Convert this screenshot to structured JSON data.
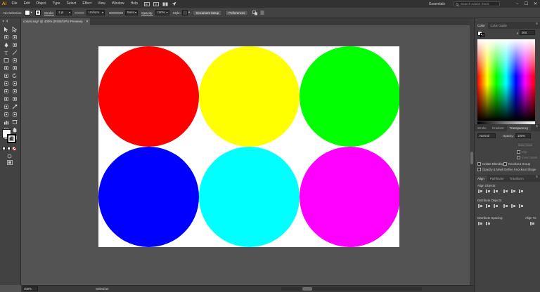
{
  "app": {
    "logo": "Ai"
  },
  "menu": {
    "items": [
      "File",
      "Edit",
      "Object",
      "Type",
      "Select",
      "Effect",
      "View",
      "Window",
      "Help"
    ]
  },
  "menubar_right": {
    "workspace": "Essentials",
    "search_placeholder": "Search Adobe Stock",
    "window_controls": [
      "–",
      "☐",
      "✕"
    ]
  },
  "control_bar": {
    "selection_label": "No Selection",
    "fill_color": "#ffffff",
    "stroke_label": "Stroke:",
    "stroke_weight": "1 pt",
    "profile_label": "Uniform",
    "brush_label": "Basic",
    "opacity_label": "Opacity:",
    "opacity_value": "100%",
    "style_label": "Style:",
    "document_setup_button": "Document Setup",
    "preferences_button": "Preferences"
  },
  "document": {
    "tab_title": "colors.svg* @ 400% (RGB/GPU Preview)",
    "close_glyph": "✕",
    "artboard_color": "#ffffff",
    "circles": [
      {
        "name": "red",
        "color": "#ff0000"
      },
      {
        "name": "yellow",
        "color": "#ffff00"
      },
      {
        "name": "green",
        "color": "#00ff00"
      },
      {
        "name": "blue",
        "color": "#0000ff"
      },
      {
        "name": "cyan",
        "color": "#00ffff"
      },
      {
        "name": "magenta",
        "color": "#ff00ff"
      }
    ]
  },
  "status_bar": {
    "zoom": "400%",
    "tool_name": "Selection"
  },
  "panels": {
    "color": {
      "tabs": [
        "Color",
        "Color Guide"
      ],
      "hex_value": "000"
    },
    "transparency": {
      "tabs": [
        "Stroke",
        "Gradient",
        "Transparency"
      ],
      "blend_mode": "Normal",
      "opacity_label": "Opacity:",
      "opacity_value": "100%",
      "make_mask_button": "Make Mask",
      "clip_label": "Clip",
      "invert_mask_label": "Invert Mask",
      "isolate_blending_label": "Isolate Blending",
      "knockout_group_label": "Knockout Group",
      "opacity_mask_label": "Opacity & Mask Define Knockout Shape"
    },
    "align": {
      "tabs": [
        "Align",
        "Pathfinder",
        "Transform"
      ],
      "align_objects_label": "Align Objects:",
      "distribute_objects_label": "Distribute Objects:",
      "distribute_spacing_label": "Distribute Spacing:",
      "align_to_label": "Align To:"
    }
  },
  "tools": {
    "icons": [
      "selection-tool-icon",
      "direct-selection-tool-icon",
      "magic-wand-tool-icon",
      "lasso-tool-icon",
      "pen-tool-icon",
      "curvature-tool-icon",
      "type-tool-icon",
      "line-segment-tool-icon",
      "rectangle-tool-icon",
      "paintbrush-tool-icon",
      "shaper-tool-icon",
      "pencil-tool-icon",
      "eraser-tool-icon",
      "rotate-tool-icon",
      "scale-tool-icon",
      "width-tool-icon",
      "free-transform-tool-icon",
      "shape-builder-tool-icon",
      "perspective-grid-tool-icon",
      "mesh-tool-icon",
      "gradient-tool-icon",
      "eyedropper-tool-icon",
      "blend-tool-icon",
      "symbol-sprayer-tool-icon",
      "column-graph-tool-icon",
      "artboard-tool-icon",
      "slice-tool-icon",
      "hand-tool-icon",
      "zoom-tool-icon",
      "scissors-tool-icon"
    ]
  }
}
